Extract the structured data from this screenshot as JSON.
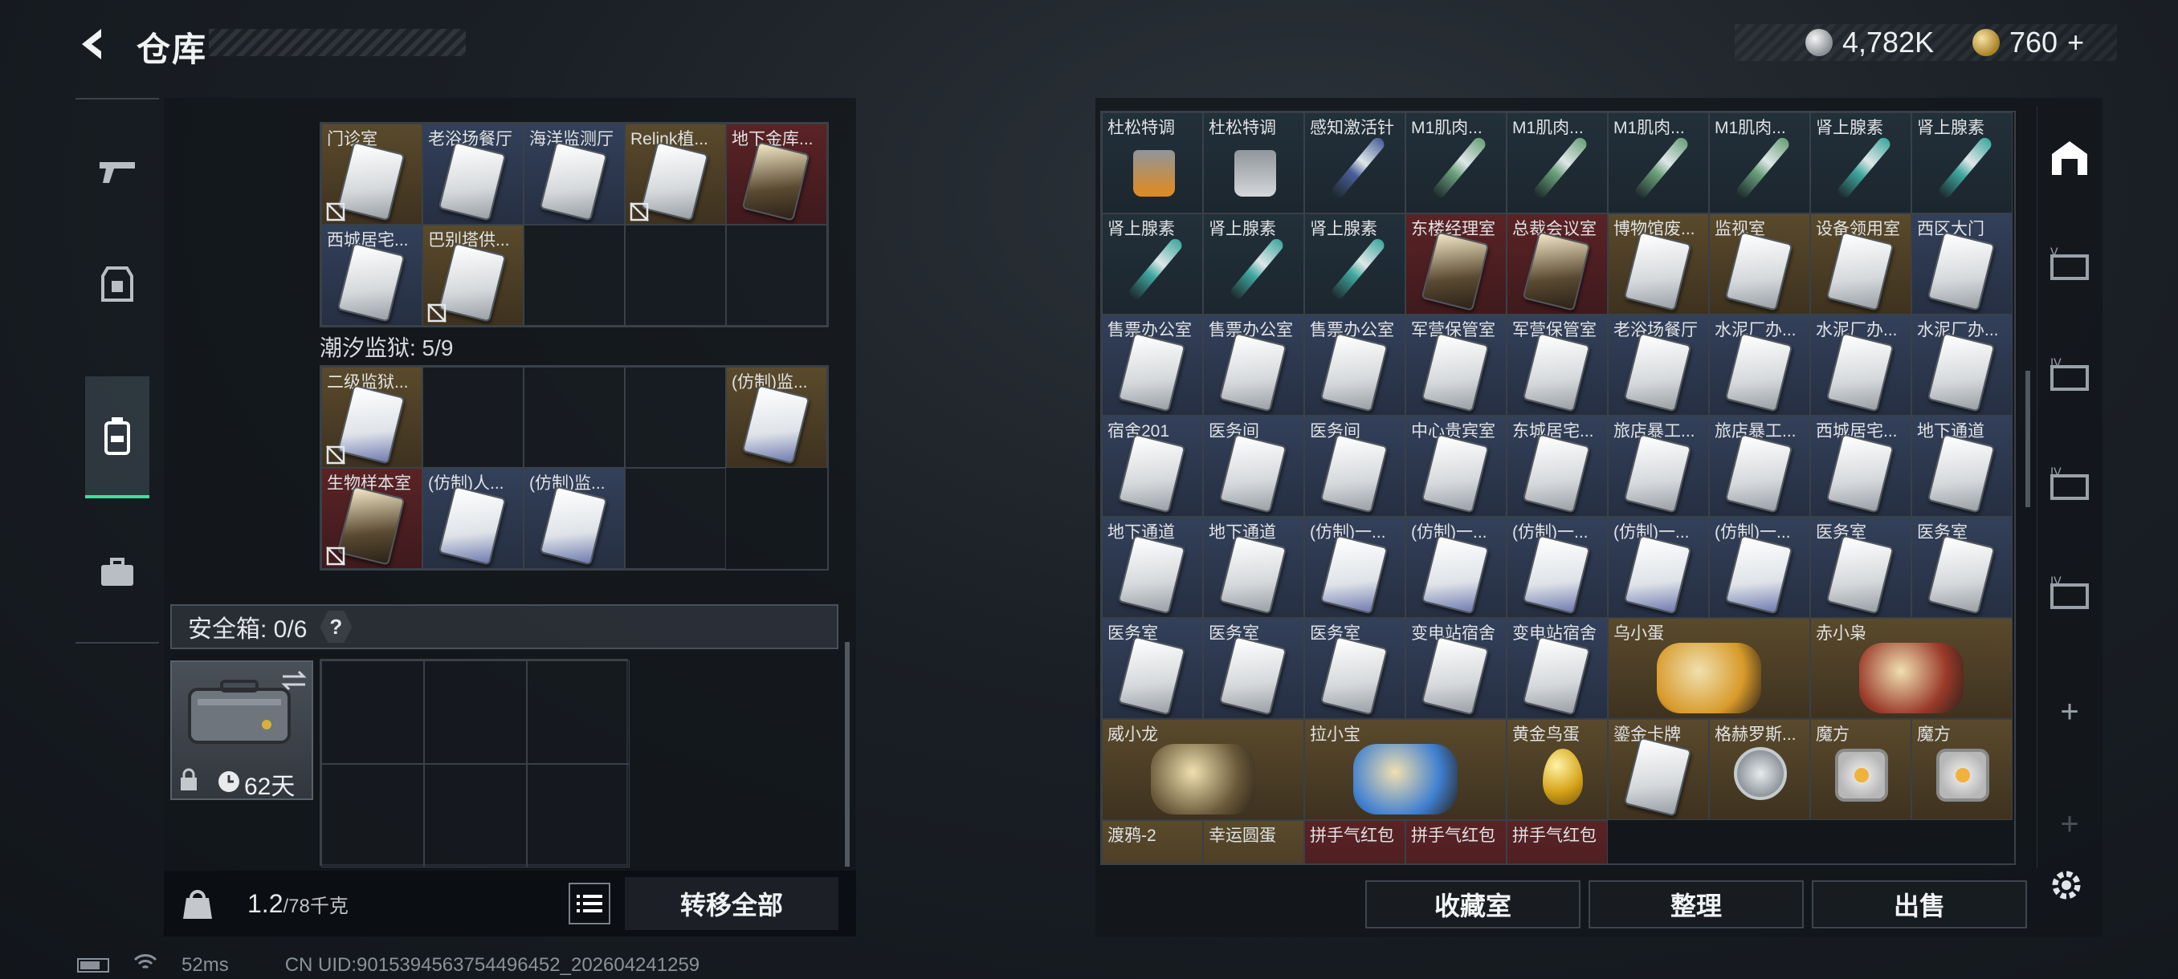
{
  "header": {
    "title": "仓库",
    "silver_amount": "4,782K",
    "gold_amount": "760",
    "gold_plus": "+"
  },
  "left_stash": {
    "top_rows": [
      [
        {
          "name": "门诊室",
          "style": "gold",
          "card": "light",
          "nosell": true
        },
        {
          "name": "老浴场餐厅",
          "style": "blue",
          "card": "light",
          "nosell": false
        },
        {
          "name": "海洋监测厅",
          "style": "blue",
          "card": "light",
          "nosell": false
        },
        {
          "name": "Relink植...",
          "style": "gold",
          "card": "light",
          "nosell": true
        },
        {
          "name": "地下金库...",
          "style": "red",
          "card": "dark",
          "nosell": false
        }
      ],
      [
        {
          "name": "西城居宅...",
          "style": "blue",
          "card": "light",
          "nosell": false
        },
        {
          "name": "巴别塔供...",
          "style": "gold",
          "card": "light",
          "nosell": true
        },
        {
          "name": "",
          "style": "empty"
        },
        {
          "name": "",
          "style": "empty"
        },
        {
          "name": "",
          "style": "empty"
        }
      ]
    ],
    "prison_label": "潮汐监狱: 5/9",
    "prison_rows": [
      [
        {
          "name": "二级监狱...",
          "style": "gold",
          "card": "fake",
          "nosell": true
        },
        {
          "name": "",
          "style": "empty"
        },
        {
          "name": "",
          "style": "empty"
        },
        {
          "name": "",
          "style": "empty"
        },
        {
          "name": "(仿制)监...",
          "style": "gold",
          "card": "fake",
          "nosell": false
        }
      ],
      [
        {
          "name": "生物样本室",
          "style": "red",
          "card": "dark",
          "nosell": true
        },
        {
          "name": "(仿制)人...",
          "style": "blue",
          "card": "fake",
          "nosell": false
        },
        {
          "name": "(仿制)监...",
          "style": "blue",
          "card": "fake",
          "nosell": false
        },
        {
          "name": "",
          "style": "empty"
        }
      ]
    ],
    "safe_box_label": "安全箱: 0/6",
    "safe_box_help": "?",
    "case_days": "62天",
    "weight_current": "1.2",
    "weight_max": "/78千克",
    "transfer_all": "转移全部"
  },
  "right_stash": {
    "items": [
      {
        "name": "杜松特调",
        "kind": "drink",
        "color": "#e48a1c"
      },
      {
        "name": "杜松特调",
        "kind": "drink",
        "color": "#d5d8db"
      },
      {
        "name": "感知激活针",
        "kind": "syringe",
        "color": "#4a5f9a"
      },
      {
        "name": "M1肌肉...",
        "kind": "syringe",
        "color": "#6aa07a"
      },
      {
        "name": "M1肌肉...",
        "kind": "syringe",
        "color": "#6aa07a"
      },
      {
        "name": "M1肌肉...",
        "kind": "syringe",
        "color": "#6aa07a"
      },
      {
        "name": "M1肌肉...",
        "kind": "syringe",
        "color": "#6aa07a"
      },
      {
        "name": "肾上腺素",
        "kind": "syringe",
        "color": "#3fa8a0"
      },
      {
        "name": "肾上腺素",
        "kind": "syringe",
        "color": "#3fa8a0"
      },
      {
        "name": "肾上腺素",
        "kind": "syringe",
        "color": "#3fa8a0"
      },
      {
        "name": "肾上腺素",
        "kind": "syringe",
        "color": "#3fa8a0"
      },
      {
        "name": "肾上腺素",
        "kind": "syringe",
        "color": "#3fa8a0"
      },
      {
        "name": "东楼经理室",
        "kind": "card",
        "style": "red"
      },
      {
        "name": "总裁会议室",
        "kind": "card",
        "style": "red"
      },
      {
        "name": "博物馆废...",
        "kind": "card",
        "style": "gold"
      },
      {
        "name": "监视室",
        "kind": "card",
        "style": "gold"
      },
      {
        "name": "设备领用室",
        "kind": "card",
        "style": "gold"
      },
      {
        "name": "西区大门",
        "kind": "card",
        "style": "blue"
      },
      {
        "name": "售票办公室",
        "kind": "card",
        "style": "blue"
      },
      {
        "name": "售票办公室",
        "kind": "card",
        "style": "blue"
      },
      {
        "name": "售票办公室",
        "kind": "card",
        "style": "blue"
      },
      {
        "name": "军营保管室",
        "kind": "card",
        "style": "blue"
      },
      {
        "name": "军营保管室",
        "kind": "card",
        "style": "blue"
      },
      {
        "name": "老浴场餐厅",
        "kind": "card",
        "style": "blue"
      },
      {
        "name": "水泥厂办...",
        "kind": "card",
        "style": "blue"
      },
      {
        "name": "水泥厂办...",
        "kind": "card",
        "style": "blue"
      },
      {
        "name": "水泥厂办...",
        "kind": "card",
        "style": "blue"
      },
      {
        "name": "宿舍201",
        "kind": "card",
        "style": "blue"
      },
      {
        "name": "医务间",
        "kind": "card",
        "style": "blue"
      },
      {
        "name": "医务间",
        "kind": "card",
        "style": "blue"
      },
      {
        "name": "中心贵宾室",
        "kind": "card",
        "style": "blue"
      },
      {
        "name": "东城居宅...",
        "kind": "card",
        "style": "blue"
      },
      {
        "name": "旅店暴工...",
        "kind": "card",
        "style": "blue"
      },
      {
        "name": "旅店暴工...",
        "kind": "card",
        "style": "blue"
      },
      {
        "name": "西城居宅...",
        "kind": "card",
        "style": "blue"
      },
      {
        "name": "地下通道",
        "kind": "card",
        "style": "blue"
      },
      {
        "name": "地下通道",
        "kind": "card",
        "style": "blue"
      },
      {
        "name": "地下通道",
        "kind": "card",
        "style": "blue"
      },
      {
        "name": "(仿制)一...",
        "kind": "fake",
        "style": "blue"
      },
      {
        "name": "(仿制)一...",
        "kind": "fake",
        "style": "blue"
      },
      {
        "name": "(仿制)一...",
        "kind": "fake",
        "style": "blue"
      },
      {
        "name": "(仿制)一...",
        "kind": "fake",
        "style": "blue"
      },
      {
        "name": "(仿制)一...",
        "kind": "fake",
        "style": "blue"
      },
      {
        "name": "医务室",
        "kind": "card",
        "style": "blue"
      },
      {
        "name": "医务室",
        "kind": "card",
        "style": "blue"
      },
      {
        "name": "医务室",
        "kind": "card",
        "style": "blue"
      },
      {
        "name": "医务室",
        "kind": "card",
        "style": "blue"
      },
      {
        "name": "医务室",
        "kind": "card",
        "style": "blue"
      },
      {
        "name": "变电站宿舍",
        "kind": "card",
        "style": "blue"
      },
      {
        "name": "变电站宿舍",
        "kind": "card",
        "style": "blue"
      },
      {
        "name": "乌小蛋",
        "kind": "figure",
        "style": "gold",
        "wide": true,
        "color": "#d89a2a"
      },
      {
        "name": "赤小枭",
        "kind": "figure",
        "style": "gold",
        "wide": true,
        "color": "#9a3a2a"
      },
      {
        "name": "威小龙",
        "kind": "figure",
        "style": "gold",
        "wide": true,
        "color": "#6a5a3a"
      },
      {
        "name": "拉小宝",
        "kind": "figure",
        "style": "gold",
        "wide": true,
        "color": "#3f7fd0"
      },
      {
        "name": "黄金鸟蛋",
        "kind": "egg",
        "style": "gold"
      },
      {
        "name": "鎏金卡牌",
        "kind": "card",
        "style": "gold"
      },
      {
        "name": "格赫罗斯...",
        "kind": "medal",
        "style": "gold"
      },
      {
        "name": "魔方",
        "kind": "cube",
        "style": "gold"
      },
      {
        "name": "魔方",
        "kind": "cube",
        "style": "gold"
      },
      {
        "name": "渡鸦-2",
        "kind": "none",
        "style": "gold"
      },
      {
        "name": "幸运圆蛋",
        "kind": "none",
        "style": "gold"
      },
      {
        "name": "拼手气红包",
        "kind": "none",
        "style": "red"
      },
      {
        "name": "拼手气红包",
        "kind": "none",
        "style": "red"
      },
      {
        "name": "拼手气红包",
        "kind": "none",
        "style": "red"
      }
    ],
    "buttons": {
      "collection": "收藏室",
      "sort": "整理",
      "sell": "出售"
    },
    "side_tabs": [
      "",
      "",
      "",
      "",
      "",
      "+",
      "+"
    ]
  },
  "status_bar": {
    "ping": "52ms",
    "uid": "CN UID:9015394563754496452_202604241259"
  }
}
